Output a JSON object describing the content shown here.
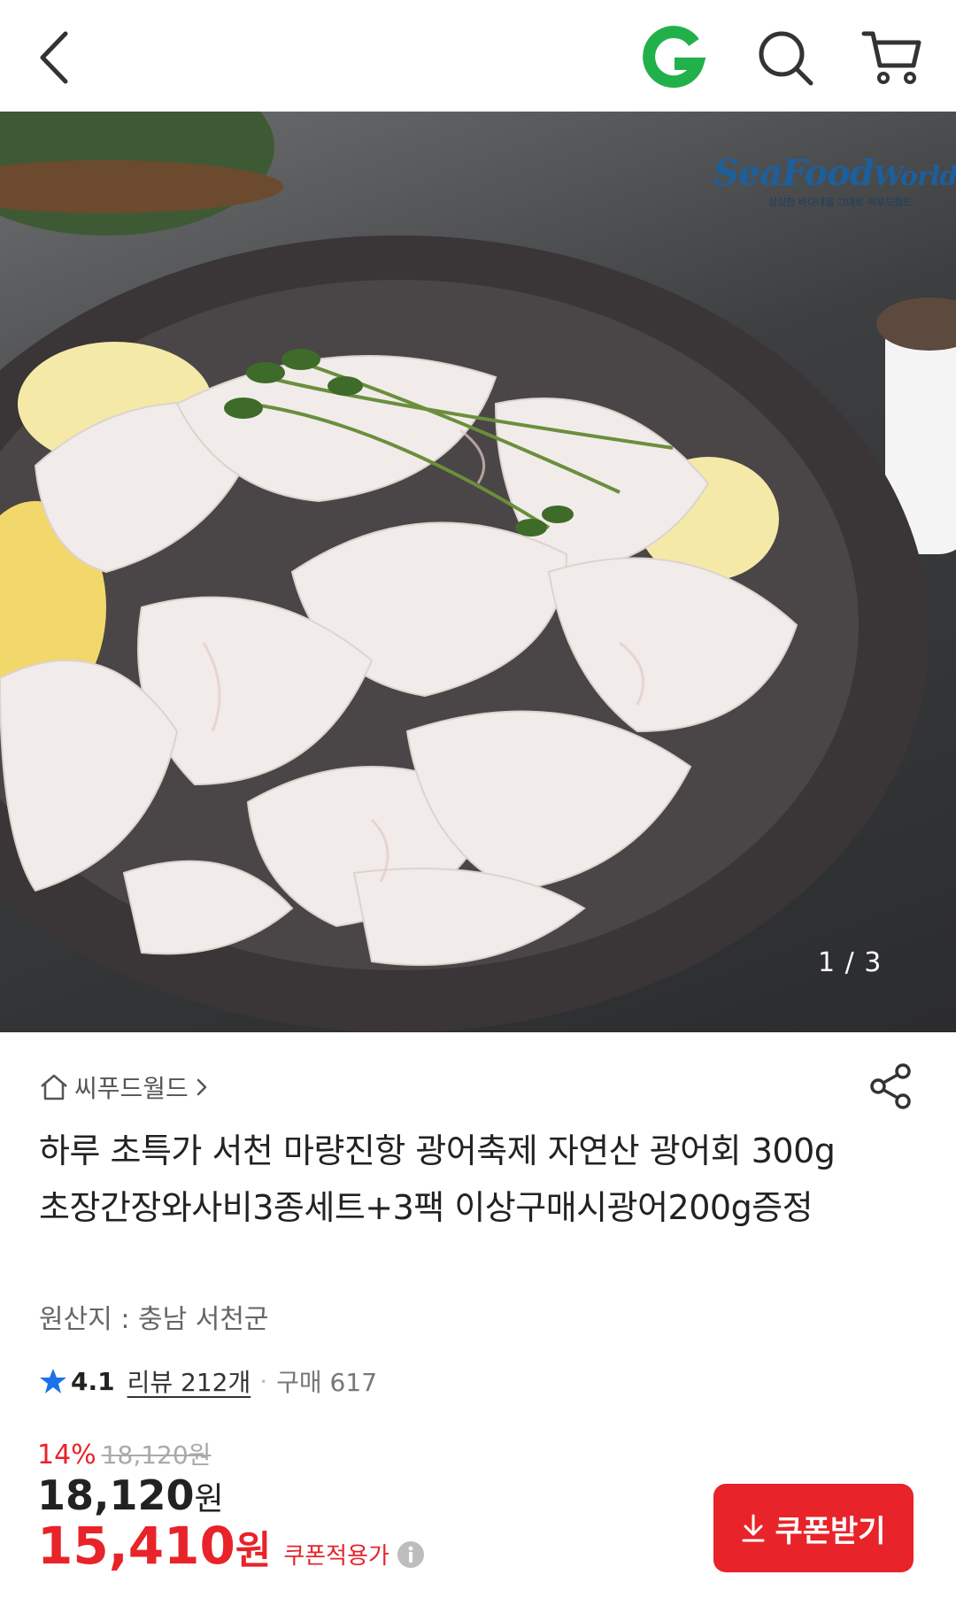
{
  "header": {
    "back_icon": "chevron-left-icon",
    "brand_icon": "g-logo-icon",
    "search_icon": "search-icon",
    "cart_icon": "cart-icon",
    "brand_color": "#21b14a"
  },
  "gallery": {
    "logo_text_sea": "Sea",
    "logo_text_food": "Food",
    "logo_text_world": "World",
    "logo_tagline": "싱싱한 바다내음 그대로 씨푸드월드",
    "counter": "1 / 3"
  },
  "product": {
    "seller": "씨푸드월드",
    "title": "하루 초특가 서천 마량진항 광어축제 자연산 광어회 300g 초장간장와사비3종세트+3팩 이상구매시광어200g증정",
    "origin": "원산지 : 충남 서천군",
    "rating": "4.1",
    "reviews": "리뷰 212개",
    "separator": "·",
    "purchases": "구매 617",
    "discount_rate": "14%",
    "original_price": "18,120원",
    "price_value": "18,120",
    "price_unit": "원",
    "coupon_price_value": "15,410",
    "coupon_price_unit": "원",
    "coupon_price_label": "쿠폰적용가",
    "coupon_button": "쿠폰받기"
  },
  "colors": {
    "accent": "#e8232a",
    "rating_star": "#1a73e8"
  }
}
